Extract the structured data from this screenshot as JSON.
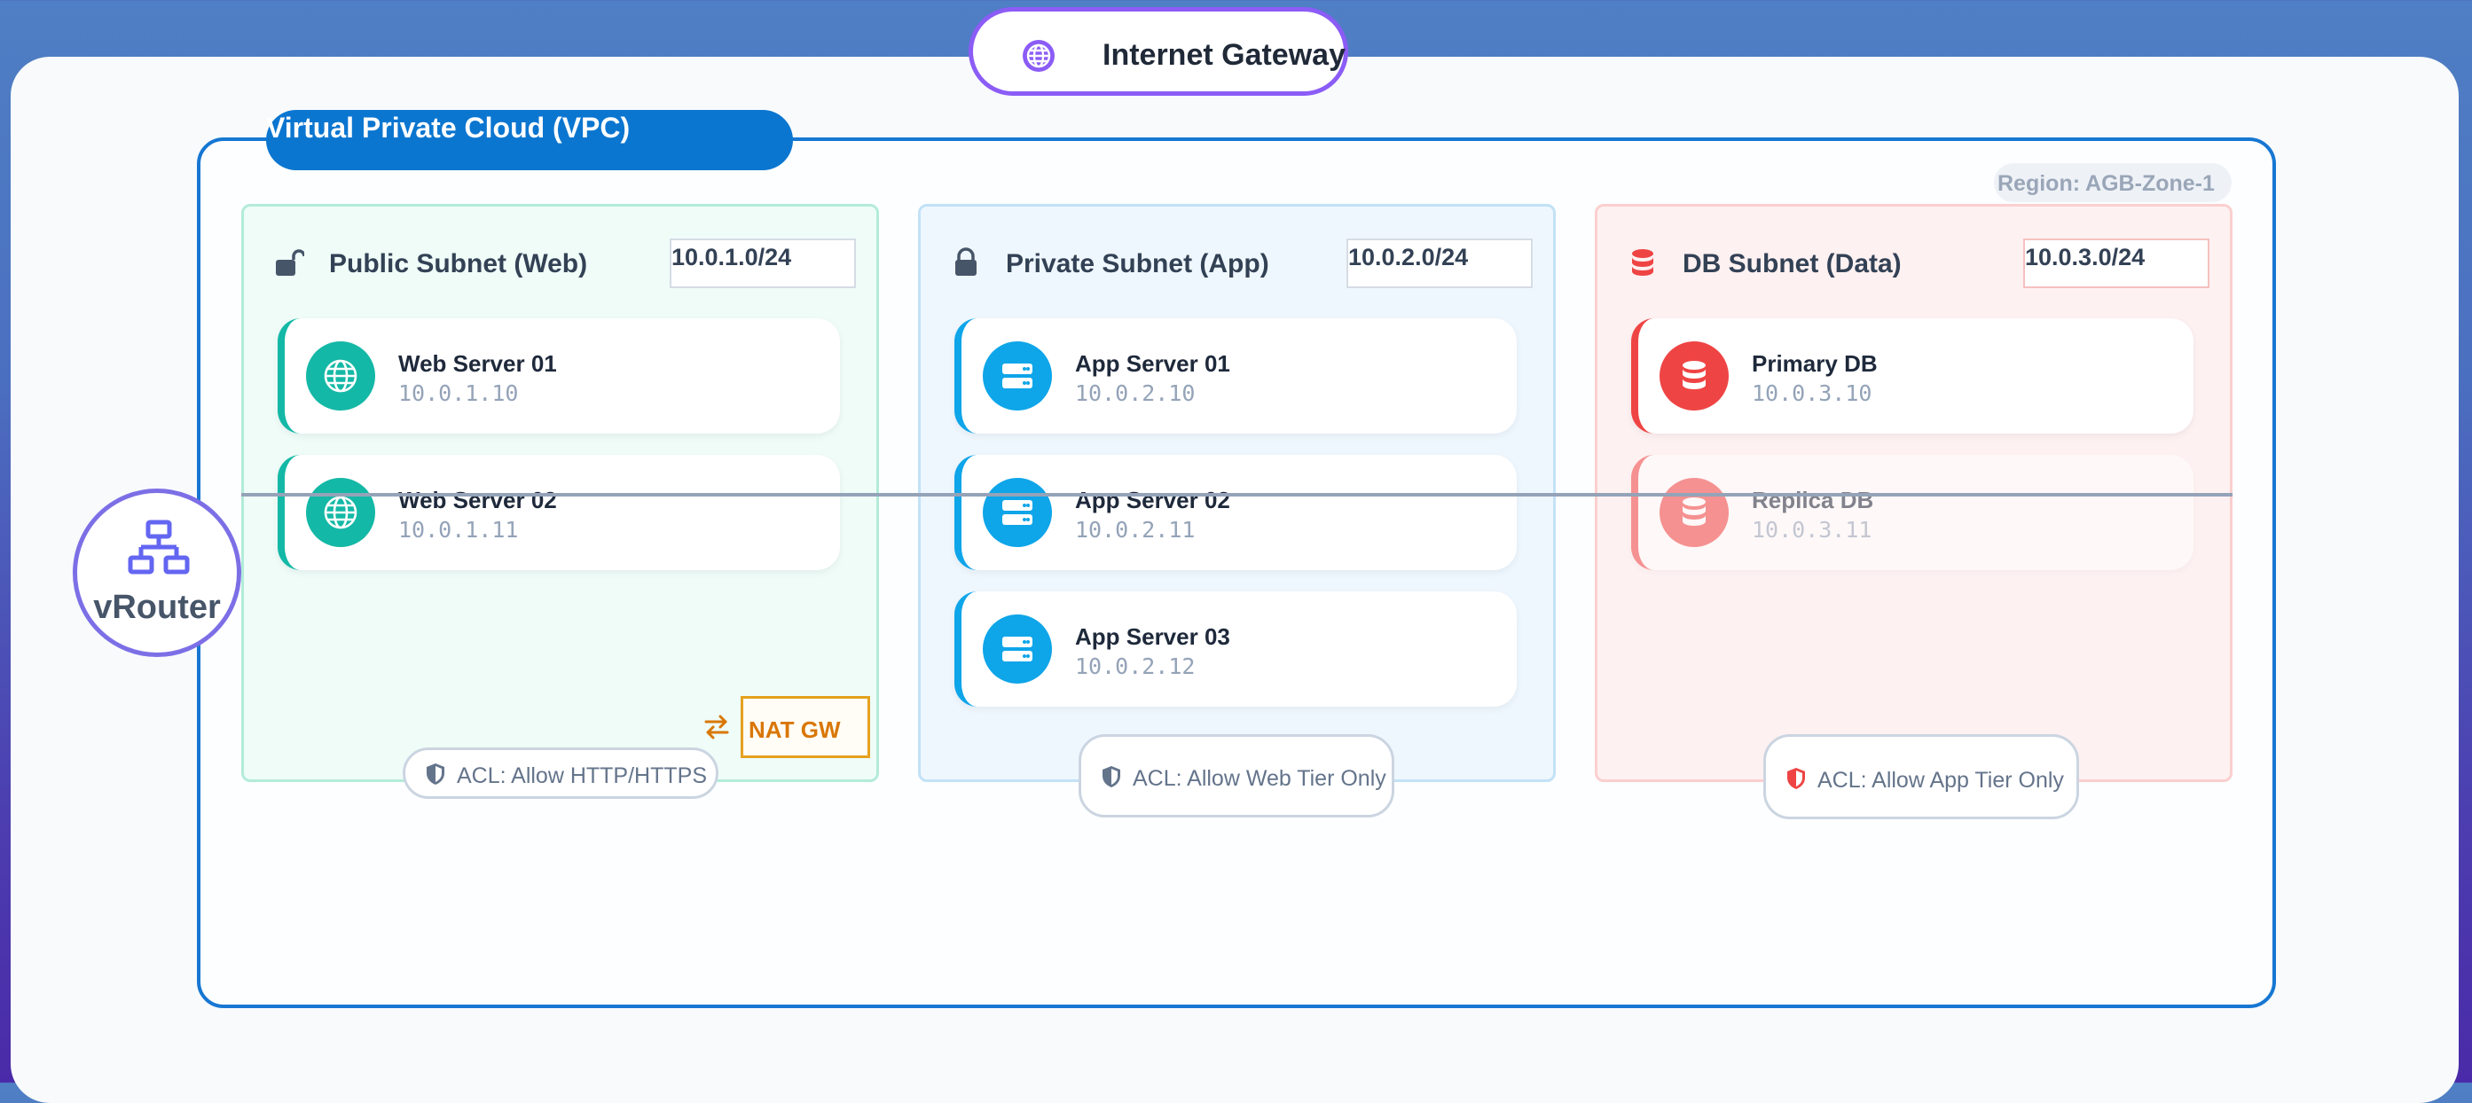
{
  "gateway": {
    "label": "Internet Gateway",
    "icon": "globe-icon",
    "accent": "#8b5cf6"
  },
  "vpc": {
    "title": "Virtual Private Cloud (VPC)",
    "region": "Region: AGB-Zone-1",
    "border_color": "#1777d2"
  },
  "router": {
    "label": "vRouter",
    "icon": "network-icon"
  },
  "subnets": [
    {
      "title": "Public Subnet (Web)",
      "cidr": "10.0.1.0/24",
      "icon": "unlock-icon",
      "accent": "#14b8a6",
      "servers": [
        {
          "name": "Web Server 01",
          "ip": "10.0.1.10",
          "icon": "globe-icon"
        },
        {
          "name": "Web Server 02",
          "ip": "10.0.1.11",
          "icon": "globe-icon"
        }
      ],
      "nat": "NAT GW",
      "acl": "ACL: Allow HTTP/HTTPS"
    },
    {
      "title": "Private Subnet (App)",
      "cidr": "10.0.2.0/24",
      "icon": "lock-icon",
      "accent": "#0ea5e9",
      "servers": [
        {
          "name": "App Server 01",
          "ip": "10.0.2.10",
          "icon": "server-icon"
        },
        {
          "name": "App Server 02",
          "ip": "10.0.2.11",
          "icon": "server-icon"
        },
        {
          "name": "App Server 03",
          "ip": "10.0.2.12",
          "icon": "server-icon"
        }
      ],
      "acl": "ACL: Allow Web Tier Only"
    },
    {
      "title": "DB Subnet (Data)",
      "cidr": "10.0.3.0/24",
      "icon": "database-icon",
      "accent": "#ef4444",
      "servers": [
        {
          "name": "Primary DB",
          "ip": "10.0.3.10",
          "icon": "database-icon"
        },
        {
          "name": "Replica DB",
          "ip": "10.0.3.11",
          "icon": "database-icon"
        }
      ],
      "acl": "ACL: Allow App Tier Only"
    }
  ]
}
